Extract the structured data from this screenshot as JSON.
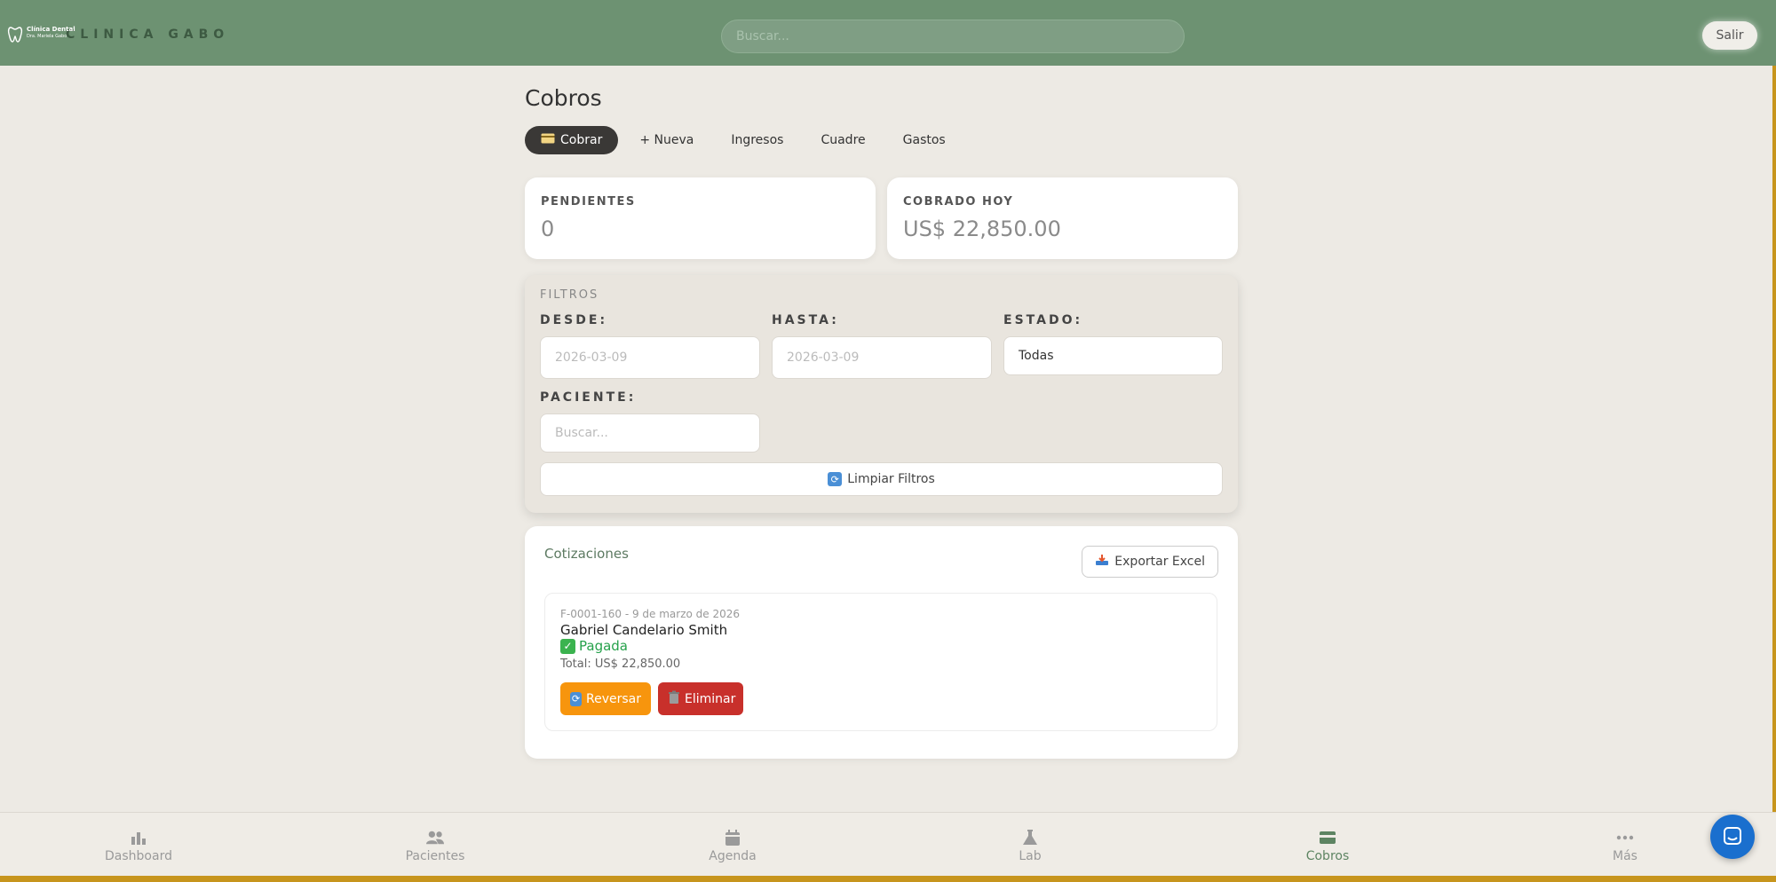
{
  "header": {
    "logo_line1": "Clínica Dental",
    "logo_line2": "Dra. Mariela Gabo",
    "brand": "CLINICA GABO",
    "search_placeholder": "Buscar...",
    "logout_label": "Salir"
  },
  "page": {
    "title": "Cobros",
    "tabs": [
      {
        "label": "Cobrar",
        "icon": "card-icon",
        "active": true
      },
      {
        "label": "+ Nueva"
      },
      {
        "label": "Ingresos"
      },
      {
        "label": "Cuadre"
      },
      {
        "label": "Gastos"
      }
    ]
  },
  "stats": {
    "pending_label": "PENDIENTES",
    "pending_value": "0",
    "collected_label": "COBRADO HOY",
    "collected_value": "US$ 22,850.00"
  },
  "filters": {
    "title": "FILTROS",
    "from_label": "DESDE:",
    "from_value": "2026-03-09",
    "to_label": "HASTA:",
    "to_value": "2026-03-09",
    "status_label": "ESTADO:",
    "status_value": "Todas",
    "patient_label": "PACIENTE:",
    "patient_placeholder": "Buscar...",
    "clear_label": "Limpiar Filtros"
  },
  "quotes": {
    "title": "Cotizaciones",
    "export_label": "Exportar Excel",
    "items": [
      {
        "meta": "F-0001-160 - 9 de marzo de 2026",
        "patient": "Gabriel Candelario Smith",
        "status": "Pagada",
        "total": "Total: US$ 22,850.00",
        "reverse_label": "Reversar",
        "delete_label": "Eliminar"
      }
    ]
  },
  "nav": {
    "items": [
      {
        "label": "Dashboard",
        "icon": "bar-chart-icon"
      },
      {
        "label": "Pacientes",
        "icon": "users-icon"
      },
      {
        "label": "Agenda",
        "icon": "calendar-icon"
      },
      {
        "label": "Lab",
        "icon": "flask-icon"
      },
      {
        "label": "Cobros",
        "icon": "credit-card-icon",
        "active": true
      },
      {
        "label": "Más",
        "icon": "more-dots-icon"
      }
    ]
  },
  "colors": {
    "header_bg": "#6d9272",
    "accent_green": "#5d8462",
    "status_paid": "#26a14b",
    "reverse_btn": "#f7950d",
    "delete_btn": "#c8302b",
    "chat_fab": "#1a6fce"
  }
}
